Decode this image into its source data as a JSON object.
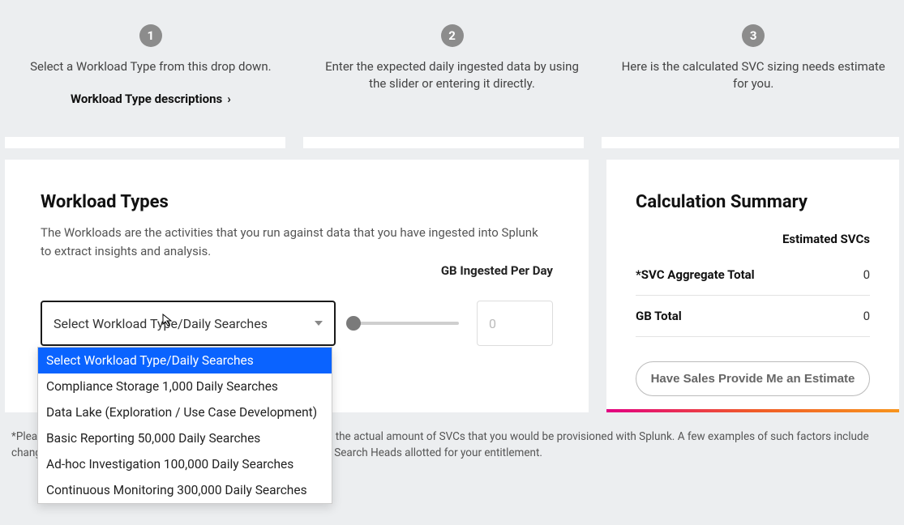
{
  "steps": {
    "s1": {
      "num": "1",
      "text": "Select a Workload Type from this drop down."
    },
    "s2": {
      "num": "2",
      "text": "Enter the expected daily ingested data by using the slider or entering it directly."
    },
    "s3": {
      "num": "3",
      "text": "Here is the calculated SVC sizing needs estimate for you."
    }
  },
  "workload_desc_link": "Workload Type descriptions",
  "workload": {
    "title": "Workload Types",
    "description": "The Workloads are the activities that you run against data that you have ingested into Splunk to extract insights and analysis.",
    "gb_label": "GB Ingested Per Day",
    "select_placeholder": "Select Workload Type/Daily Searches",
    "gb_value": "0",
    "options": {
      "o0": "Select Workload Type/Daily Searches",
      "o1": "Compliance Storage 1,000 Daily Searches",
      "o2": "Data Lake (Exploration / Use Case Development)",
      "o3": "Basic Reporting 50,000 Daily Searches",
      "o4": "Ad-hoc Investigation 100,000 Daily Searches",
      "o5": "Continuous Monitoring 300,000 Daily Searches"
    }
  },
  "summary": {
    "title": "Calculation Summary",
    "header": "Estimated SVCs",
    "rows": {
      "agg": {
        "label": "*SVC Aggregate Total",
        "value": "0"
      },
      "gb": {
        "label": "GB Total",
        "value": "0"
      }
    },
    "button": "Have Sales Provide Me an Estimate"
  },
  "footnote": "*Please note that there are a variety of factors that could influence the actual amount of SVCs that you would be provisioned with Splunk. A few examples of such factors include changing or unknown use cases, and the proportion of Indexers to Search Heads allotted for your entitlement."
}
